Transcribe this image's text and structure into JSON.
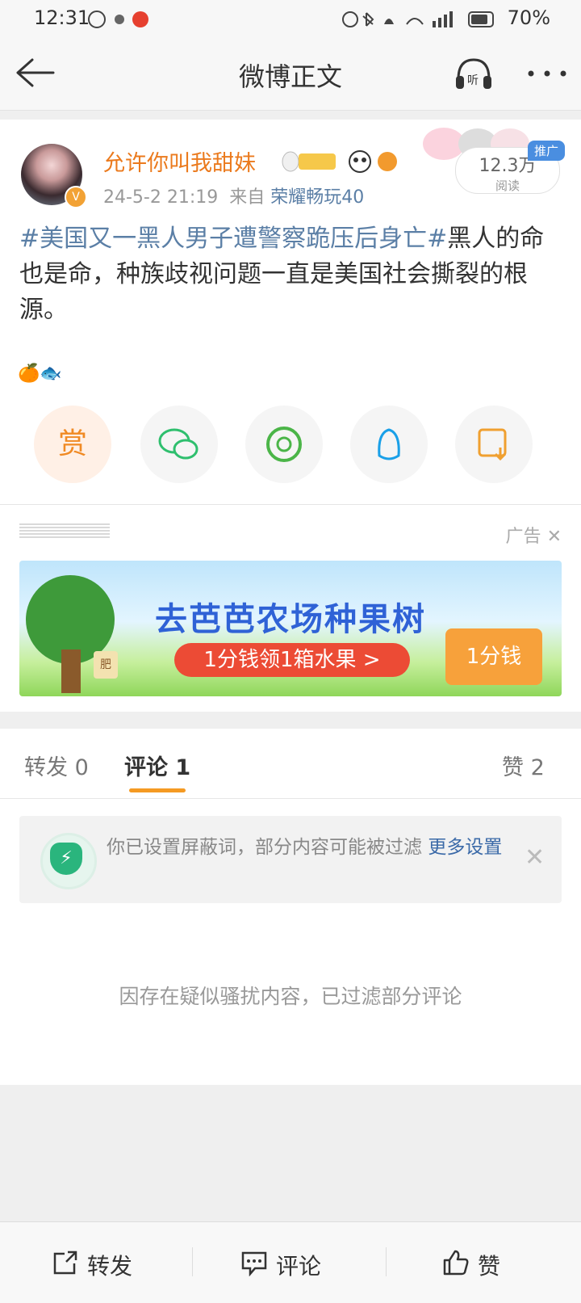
{
  "status": {
    "time": "12:31",
    "battery": "70%"
  },
  "nav": {
    "title": "微博正文"
  },
  "post": {
    "username": "允许你叫我甜妹",
    "time": "24-5-2 21:19",
    "from_prefix": "来自",
    "source": "荣耀畅玩40",
    "reads": "12.3万",
    "reads_label": "阅读",
    "promo_tag": "推广",
    "topic": "#美国又一黑人男子遭警察跪压后身亡#",
    "text": "黑人的命也是命，种族歧视问题一直是美国社会撕裂的根源。",
    "emojis": "🍊🐟",
    "reward_label": "赏"
  },
  "ad": {
    "label": "广告",
    "title": "去芭芭农场种果树",
    "cta": "1分钱领1箱水果 >",
    "price": "1分钱",
    "fertilizer": "肥"
  },
  "tabs": {
    "repost": "转发 0",
    "comment": "评论 1",
    "like": "赞 2"
  },
  "notice": {
    "text": "你已设置屏蔽词，部分内容可能被过滤",
    "link": "更多设置"
  },
  "filtered_text": "因存在疑似骚扰内容，已过滤部分评论",
  "bottom": {
    "repost": "转发",
    "comment": "评论",
    "like": "赞"
  }
}
